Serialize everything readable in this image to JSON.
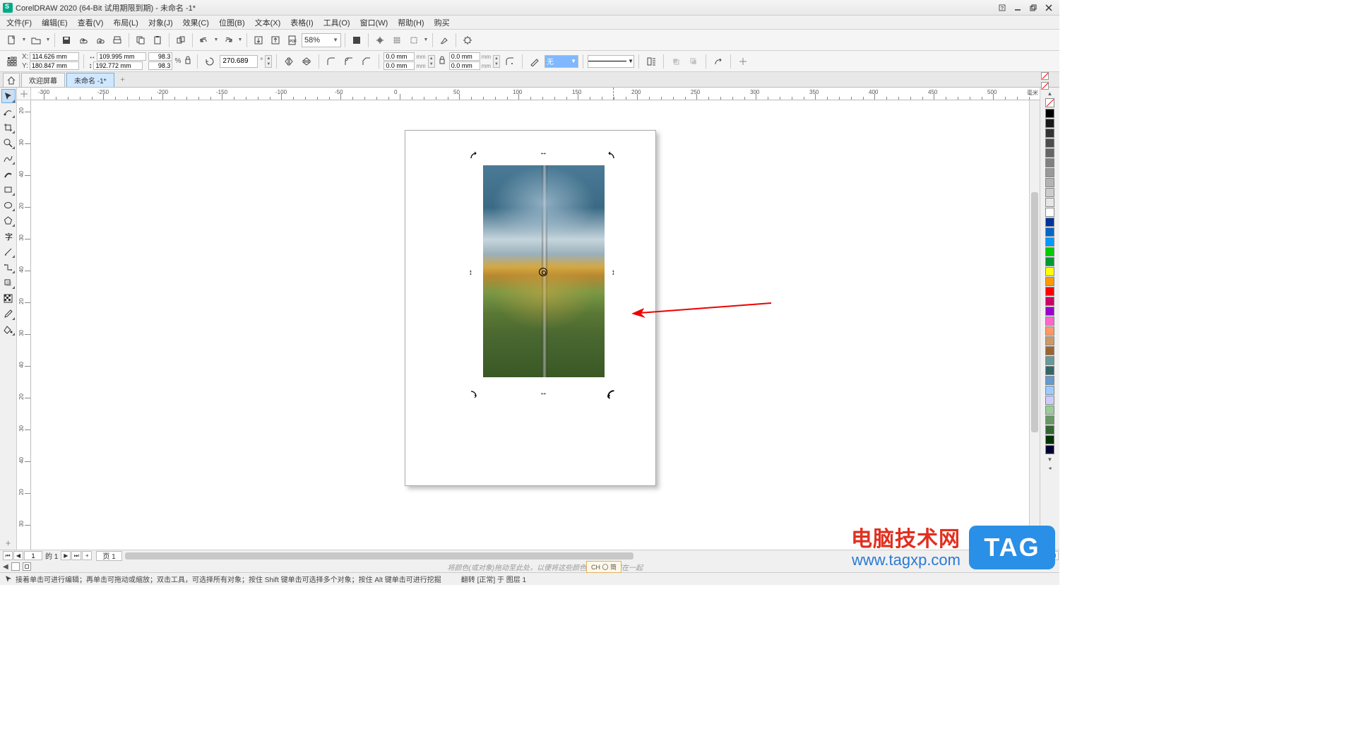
{
  "title": "CorelDRAW 2020 (64-Bit 试用期限到期) - 未命名 -1*",
  "menu": [
    "文件(F)",
    "编辑(E)",
    "查看(V)",
    "布局(L)",
    "对象(J)",
    "效果(C)",
    "位图(B)",
    "文本(X)",
    "表格(I)",
    "工具(O)",
    "窗口(W)",
    "帮助(H)",
    "购买"
  ],
  "zoom": "58%",
  "prop": {
    "x": "114.626 mm",
    "y": "180.847 mm",
    "w": "109.995 mm",
    "h": "192.772 mm",
    "sx": "98.3",
    "sy": "98.3",
    "pct": "%",
    "angle": "270.689",
    "deg": "°",
    "corner1": "0.0 mm",
    "corner2": "0.0 mm",
    "corner3": "0.0 mm",
    "corner4": "0.0 mm",
    "outline_none": "无"
  },
  "tabs": {
    "welcome": "欢迎屏幕",
    "doc": "未命名 -1*"
  },
  "ruler_h": [
    "-300",
    "-250",
    "-200",
    "-150",
    "-100",
    "-50",
    "0",
    "50",
    "100",
    "150",
    "200",
    "250",
    "300",
    "350",
    "400",
    "450",
    "500"
  ],
  "ruler_h_unit": "毫米",
  "ruler_v": [
    "20",
    "30",
    "40",
    "20",
    "30",
    "40",
    "20",
    "30",
    "40",
    "20",
    "30",
    "40",
    "20",
    "30"
  ],
  "page_nav": {
    "num": "1",
    "of": "的 1",
    "tab": "页 1"
  },
  "hint": "将颜色(或对象)拖动至此处，以便将这些颜色与文档存储在一起",
  "ime": "CH 〇 简",
  "status": {
    "text1": "接着单击可进行编辑；再单击可拖动或缩放；双击工具，可选择所有对象；按住 Shift 键单击可选择多个对象；按住 Alt 键单击可进行挖掘",
    "text2": "翻转 [正常] 于 图层 1"
  },
  "palette": [
    "#000000",
    "#1a1a1a",
    "#333333",
    "#4d4d4d",
    "#666666",
    "#808080",
    "#999999",
    "#b3b3b3",
    "#cccccc",
    "#e6e6e6",
    "#ffffff",
    "#003399",
    "#0066cc",
    "#0099ff",
    "#00cc00",
    "#009933",
    "#ffff00",
    "#ff9900",
    "#ff0000",
    "#cc0066",
    "#9900cc",
    "#ff66cc",
    "#ff9966",
    "#cc9966",
    "#996633",
    "#669999",
    "#336666",
    "#6699cc",
    "#99ccff",
    "#ccccff",
    "#99cc99",
    "#669966",
    "#336633",
    "#003300",
    "#000033"
  ],
  "watermark": {
    "line1": "电脑技术网",
    "line2": "www.tagxp.com",
    "tag": "TAG"
  }
}
